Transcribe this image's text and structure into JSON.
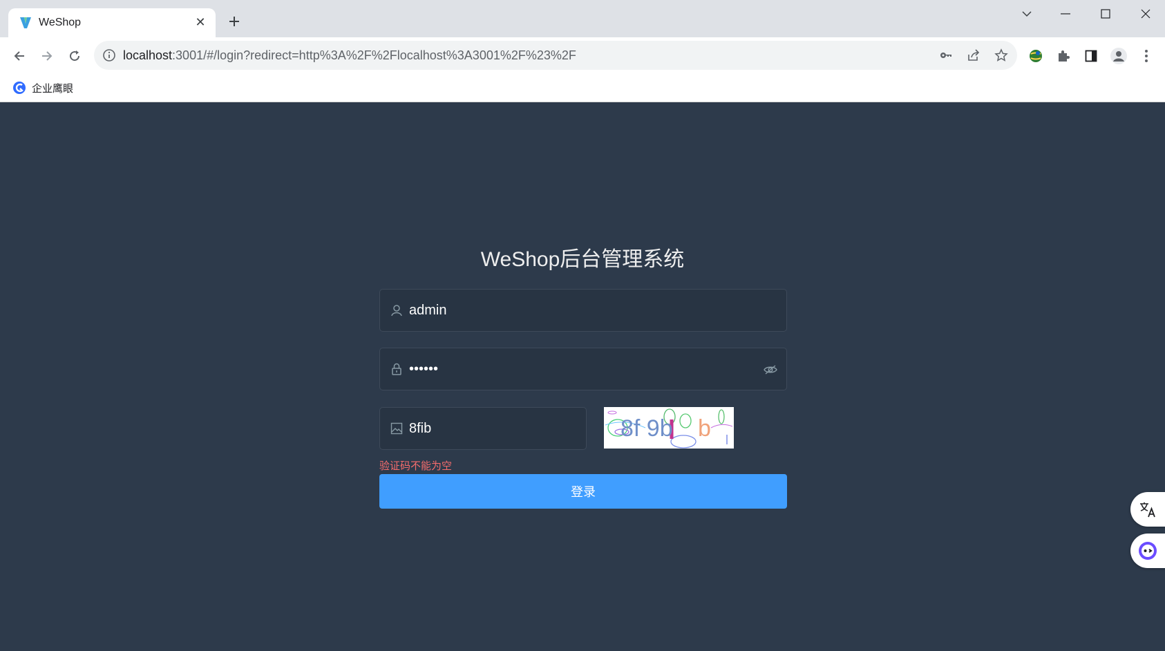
{
  "browser": {
    "tab": {
      "title": "WeShop"
    },
    "omnibox": {
      "url_host": "localhost",
      "url_rest": ":3001/#/login?redirect=http%3A%2F%2Flocalhost%3A3001%2F%23%2F"
    },
    "bookmarks": [
      {
        "label": "企业鹰眼"
      }
    ]
  },
  "login": {
    "title": "WeShop后台管理系统",
    "username": {
      "value": "admin"
    },
    "password": {
      "value": "••••••"
    },
    "captcha": {
      "value": "8fib",
      "image_text": "8f 9b"
    },
    "error": "验证码不能为空",
    "submit_label": "登录"
  },
  "colors": {
    "page_bg": "#2d3a4b",
    "input_bg": "#283443",
    "primary": "#409eff",
    "error": "#f56c6c"
  },
  "icons": {
    "username": "user-icon",
    "password": "lock-icon",
    "captcha": "image-icon",
    "eye": "eye-off-icon"
  }
}
